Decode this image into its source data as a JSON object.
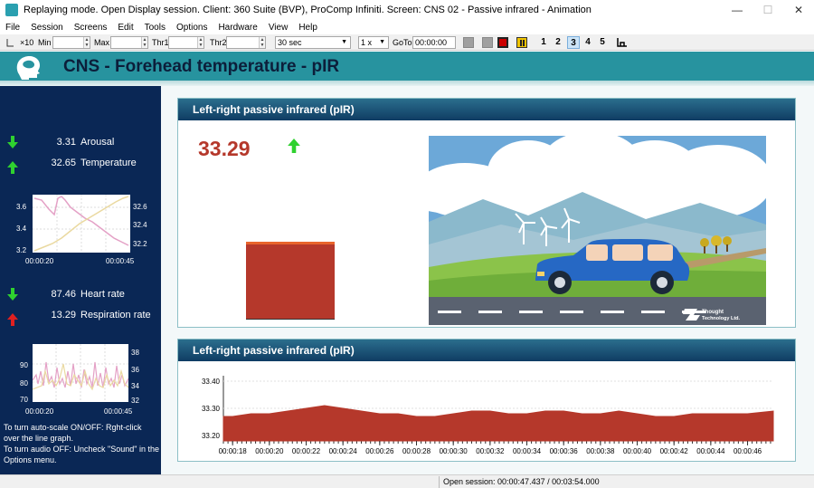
{
  "window": {
    "title": "Replaying mode. Open Display session. Client: 360 Suite (BVP), ProComp Infiniti. Screen: CNS 02 - Passive infrared - Animation",
    "minimize_glyph": "—",
    "maximize_glyph": "☐",
    "close_glyph": "✕"
  },
  "menu": [
    "File",
    "Session",
    "Screens",
    "Edit",
    "Tools",
    "Options",
    "Hardware",
    "View",
    "Help"
  ],
  "toolbar": {
    "scale_label": "×10",
    "min_label": "Min",
    "max_label": "Max",
    "thr1_label": "Thr1",
    "thr2_label": "Thr2",
    "duration_value": "30 sec",
    "speed_value": "1 x",
    "goto_label": "GoTo",
    "goto_value": "00:00:00",
    "numbers": [
      "1",
      "2",
      "3",
      "4",
      "5"
    ],
    "selected_number": "3",
    "colors": {
      "gray1": "#a0a0a0",
      "gray2": "#a0a0a0",
      "red": "#cc0000",
      "yellow": "#f0c400"
    }
  },
  "header": {
    "title": "CNS - Forehead temperature - pIR"
  },
  "sidebar": {
    "group1": [
      {
        "value": "3.31",
        "label": "Arousal",
        "trend": "down",
        "color": "#2fd12f"
      },
      {
        "value": "32.65",
        "label": "Temperature",
        "trend": "up",
        "color": "#2fd12f"
      }
    ],
    "chart1": {
      "left_ticks": [
        "3.6",
        "3.4",
        "3.2"
      ],
      "right_ticks": [
        "32.6",
        "32.4",
        "32.2"
      ],
      "x_ticks": [
        "00:00:20",
        "00:00:45"
      ]
    },
    "group2": [
      {
        "value": "87.46",
        "label": "Heart rate",
        "trend": "down",
        "color": "#2fd12f"
      },
      {
        "value": "13.29",
        "label": "Respiration rate",
        "trend": "up",
        "color": "#e02020"
      }
    ],
    "chart2": {
      "left_ticks": [
        "90",
        "80",
        "70"
      ],
      "right_ticks": [
        "38",
        "36",
        "34",
        "32"
      ],
      "x_ticks": [
        "00:00:20",
        "00:00:45"
      ]
    },
    "help1": "To turn auto-scale ON/OFF: Rght-click over the line graph.",
    "help2": "To turn audio OFF: Uncheck \"Sound\" in the Options menu."
  },
  "panel_top": {
    "title": "Left-right passive infrared (pIR)",
    "value": "33.29",
    "trend": "up",
    "bar_level": 0.95,
    "logo_text_1": "Thought",
    "logo_text_2": "Technology Ltd."
  },
  "panel_bottom": {
    "title": "Left-right passive infrared (pIR)"
  },
  "chart_data": {
    "type": "area",
    "title": "",
    "xlabel": "",
    "ylabel": "",
    "ylim": [
      33.18,
      33.4
    ],
    "y_ticks": [
      "33.40",
      "33.30",
      "33.20"
    ],
    "x_ticks": [
      "00:00:18",
      "00:00:20",
      "00:00:22",
      "00:00:24",
      "00:00:26",
      "00:00:28",
      "00:00:30",
      "00:00:32",
      "00:00:34",
      "00:00:36",
      "00:00:38",
      "00:00:40",
      "00:00:42",
      "00:00:44",
      "00:00:46"
    ],
    "color": "#b5382b",
    "x": [
      17.5,
      18,
      19,
      20,
      21,
      22,
      23,
      24,
      25,
      26,
      27,
      28,
      29,
      30,
      31,
      32,
      33,
      34,
      35,
      36,
      37,
      38,
      39,
      40,
      41,
      42,
      43,
      44,
      45,
      46,
      47.4
    ],
    "values": [
      33.27,
      33.27,
      33.28,
      33.28,
      33.29,
      33.3,
      33.31,
      33.3,
      33.29,
      33.28,
      33.28,
      33.27,
      33.27,
      33.28,
      33.29,
      33.29,
      33.28,
      33.28,
      33.29,
      33.29,
      33.28,
      33.28,
      33.29,
      33.28,
      33.27,
      33.27,
      33.28,
      33.28,
      33.28,
      33.28,
      33.29
    ]
  },
  "status": {
    "text": "Open session: 00:00:47.437 / 00:03:54.000"
  }
}
